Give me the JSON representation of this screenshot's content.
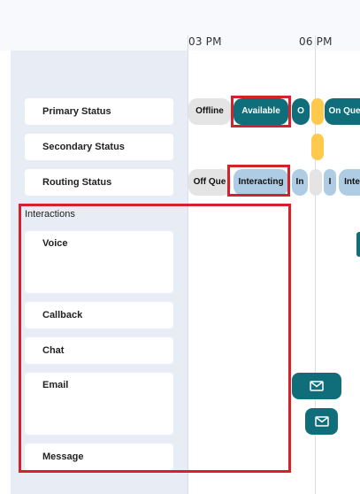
{
  "timeline": {
    "times": [
      "03 PM",
      "06 PM"
    ]
  },
  "rows": {
    "primary_status": "Primary Status",
    "secondary_status": "Secondary Status",
    "routing_status": "Routing Status"
  },
  "interactions": {
    "title": "Interactions",
    "voice": "Voice",
    "callback": "Callback",
    "chat": "Chat",
    "email": "Email",
    "message": "Message"
  },
  "primary_segments": [
    "Offline",
    "Available",
    "O",
    "On Que"
  ],
  "routing_segments": [
    "Off Que",
    "Interacting",
    "In",
    "I",
    "Inte"
  ],
  "colors": {
    "teal": "#0f6e7a",
    "light_blue": "#aecde4",
    "yellow": "#ffc94d",
    "grey": "#e4e4e4",
    "highlight_red": "#d3222a"
  },
  "icons": {
    "email_buttons": [
      "envelope-icon",
      "envelope-icon"
    ]
  }
}
